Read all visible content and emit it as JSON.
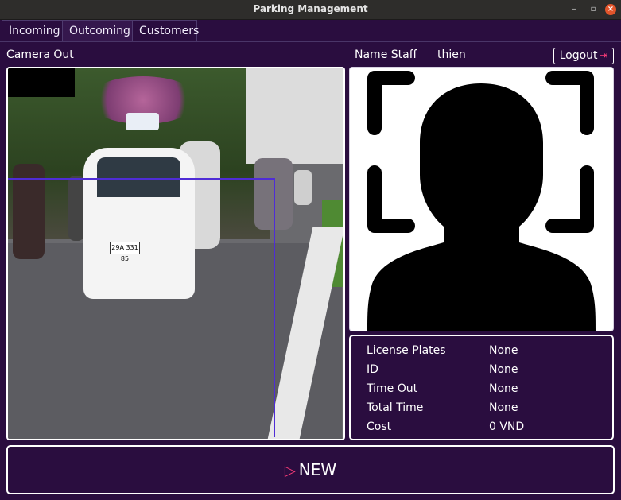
{
  "window": {
    "title": "Parking Management",
    "min_glyph": "–",
    "max_glyph": "▫",
    "close_glyph": "×"
  },
  "tabs": [
    {
      "label": "Incoming"
    },
    {
      "label": "Outcoming"
    },
    {
      "label": "Customers"
    }
  ],
  "active_tab": "Outcoming",
  "camera": {
    "label": "Camera Out",
    "plate_text": "29A 331 85"
  },
  "staff": {
    "label": "Name Staff",
    "name": "thien"
  },
  "logout": {
    "label": "Logout",
    "icon": "logout-icon"
  },
  "avatar": {
    "icon": "user-placeholder-icon"
  },
  "info": [
    {
      "key": "License Plates",
      "value": "None"
    },
    {
      "key": "ID",
      "value": "None"
    },
    {
      "key": "Time Out",
      "value": "None"
    },
    {
      "key": "Total Time",
      "value": "None"
    },
    {
      "key": "Cost",
      "value": "0 VND"
    }
  ],
  "new_button": {
    "label": "NEW",
    "icon": "play-outline-icon"
  },
  "colors": {
    "background": "#2a0d3f",
    "accent": "#ff3d7a",
    "roi": "#4f2cd6"
  }
}
